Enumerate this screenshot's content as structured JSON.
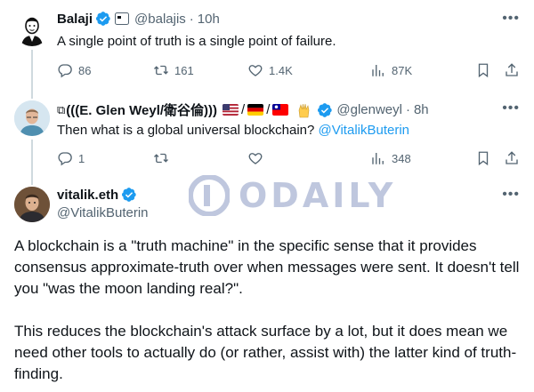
{
  "tweet1": {
    "name": "Balaji",
    "handle": "@balajis",
    "time": "10h",
    "text": "A single point of truth is a single point of failure.",
    "stats": {
      "replies": "86",
      "reposts": "161",
      "likes": "1.4K",
      "views": "87K"
    }
  },
  "tweet2": {
    "name": "(((E. Glen Weyl/衛谷倫)))",
    "handle": "@glenweyl",
    "time": "8h",
    "text_before_mention": "Then what is a global universal blockchain?",
    "mention": "@VitalikButerin",
    "stats": {
      "replies": "1",
      "reposts": "",
      "likes": "",
      "views": "348"
    }
  },
  "tweet3": {
    "name": "vitalik.eth",
    "handle": "@VitalikButerin",
    "paragraph1": "A blockchain is a \"truth machine\" in the specific sense that it provides consensus approximate-truth over when messages were sent. It doesn't tell you \"was the moon landing real?\".",
    "paragraph2": "This reduces the blockchain's attack surface by a lot, but it does mean we need other tools to actually do (or rather, assist with) the latter kind of truth-finding."
  },
  "watermark": {
    "text": "ODAILY"
  },
  "colors": {
    "accent": "#1d9bf0",
    "muted": "#536471",
    "text": "#0f1419",
    "line": "#cfd9de"
  }
}
